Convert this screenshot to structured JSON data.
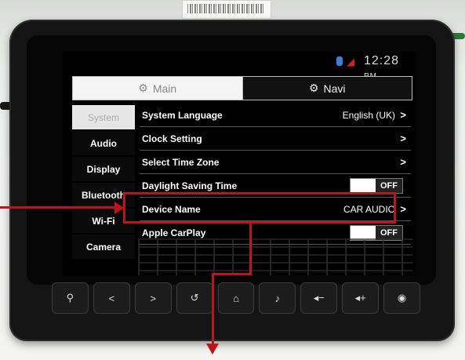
{
  "status": {
    "time": "12:28",
    "ampm": "PM"
  },
  "tabs": [
    {
      "label": "Main"
    },
    {
      "label": "Navi"
    }
  ],
  "sidebar": {
    "items": [
      {
        "label": "System"
      },
      {
        "label": "Audio"
      },
      {
        "label": "Display"
      },
      {
        "label": "Bluetooth"
      },
      {
        "label": "Wi-Fi"
      },
      {
        "label": "Camera"
      }
    ]
  },
  "settings": {
    "rows": [
      {
        "label": "System Language",
        "value": "English (UK)"
      },
      {
        "label": "Clock Setting",
        "value": ""
      },
      {
        "label": "Select Time Zone",
        "value": ""
      },
      {
        "label": "Daylight Saving Time",
        "toggle": "OFF"
      },
      {
        "label": "Device Name",
        "value": "CAR AUDIO"
      },
      {
        "label": "Apple CarPlay",
        "toggle": "OFF"
      }
    ]
  },
  "chevron": ">",
  "hardware_buttons": [
    {
      "icon": "map-pin-icon",
      "glyph": "⚲"
    },
    {
      "icon": "prev-icon",
      "glyph": "<"
    },
    {
      "icon": "next-icon",
      "glyph": ">"
    },
    {
      "icon": "back-icon",
      "glyph": "↺"
    },
    {
      "icon": "home-icon",
      "glyph": "⌂"
    },
    {
      "icon": "music-icon",
      "glyph": "♪"
    },
    {
      "icon": "volume-down-icon",
      "glyph": "◂−"
    },
    {
      "icon": "volume-up-icon",
      "glyph": "◂+"
    },
    {
      "icon": "power-icon",
      "glyph": "◉"
    }
  ],
  "annotation_color": "#c0121a"
}
